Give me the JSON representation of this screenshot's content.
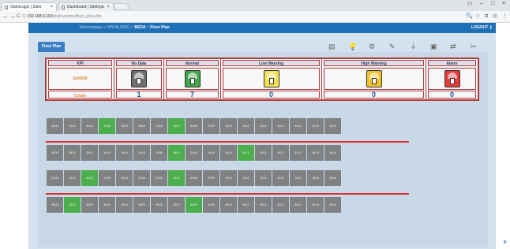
{
  "browser": {
    "tabs": [
      {
        "title": "OpenLogic | Sites",
        "active": true
      },
      {
        "title": "Dashboard | Sitelogic",
        "active": false
      }
    ],
    "url_host": "192.168.0.110",
    "url_path": "/pls/inventory/floor_plan.php",
    "back_glyph": "←",
    "forward_glyph": "→",
    "reload_glyph": "C",
    "info_glyph": "ⓘ",
    "minimize_glyph": "–",
    "maximize_glyph": "□",
    "close_glyph": "×",
    "profile_glyph": "⚇",
    "zoom_glyph": "🔍",
    "star_glyph": "☆",
    "menu_glyph": "⋮",
    "ext_glyph": "◘",
    "ext2_glyph": "◎"
  },
  "app": {
    "breadcrumb": {
      "parts": [
        "Telecompass",
        "OPENLOGIC",
        "BEDA"
      ],
      "separator": ">",
      "current": "Floor Plan"
    },
    "logout_label": "LOGOUT",
    "page_tab": "Floor Plan",
    "toolbar_icons": [
      {
        "name": "report-icon",
        "glyph": "▤"
      },
      {
        "name": "bulb-icon",
        "glyph": "💡"
      },
      {
        "name": "tools-icon",
        "glyph": "⚙"
      },
      {
        "name": "edit-icon",
        "glyph": "✎"
      },
      {
        "name": "plug-icon",
        "glyph": "⏚"
      },
      {
        "name": "image-icon",
        "glyph": "▣"
      },
      {
        "name": "cables-icon",
        "glyph": "⇄"
      },
      {
        "name": "settings-icon",
        "glyph": "✂"
      }
    ],
    "colors": {
      "header": "#1e6fb6",
      "normal": "#4cae4c",
      "nodata": "#7f8183",
      "low": "#f3e259",
      "high": "#f3c02e",
      "alarm": "#e83a3a",
      "divider": "#d63030"
    }
  },
  "kpi_table": {
    "header_kpi": "KPI",
    "row_label_status": "SAHEM",
    "row_label_count": "Count",
    "columns": [
      {
        "label": "No Data",
        "count": "1",
        "color": "#6e7072"
      },
      {
        "label": "Normal",
        "count": "7",
        "color": "#3fa64a"
      },
      {
        "label": "Low Warning",
        "count": "0",
        "color": "#f4e14f"
      },
      {
        "label": "High Warning",
        "count": "0",
        "color": "#f3c02e"
      },
      {
        "label": "Alarm",
        "count": "0",
        "color": "#e83a3a"
      }
    ]
  },
  "floor": {
    "rows": [
      {
        "cells": [
          "3300",
          "3301",
          "3302",
          "3303",
          "3304",
          "3305",
          "3306",
          "3307",
          "3308",
          "3309",
          "3310",
          "3311",
          "3312",
          "3313",
          "3314",
          "3315",
          "3316"
        ],
        "green": [
          3,
          7
        ]
      },
      {
        "cells": [
          "3400",
          "3401",
          "3402",
          "3403",
          "3404",
          "3405",
          "3406",
          "3407",
          "3408",
          "3409",
          "3410",
          "3411",
          "3412",
          "3413",
          "3414",
          "3415",
          "3416"
        ],
        "green": [
          7,
          11
        ]
      },
      {
        "cells": [
          "3100",
          "3101",
          "3102",
          "3103",
          "3104",
          "3105",
          "3106",
          "3107",
          "3108",
          "3109",
          "3110",
          "3111",
          "3112",
          "3113",
          "3114",
          "3115",
          "3116"
        ],
        "green": [
          2,
          7
        ]
      },
      {
        "cells": [
          "3600",
          "3601",
          "3602",
          "3603",
          "3604",
          "3605",
          "3606",
          "3607",
          "3608",
          "3609",
          "3610",
          "3611",
          "3612",
          "3613",
          "3614",
          "3615",
          "3616"
        ],
        "green": [
          1,
          8
        ]
      }
    ]
  }
}
